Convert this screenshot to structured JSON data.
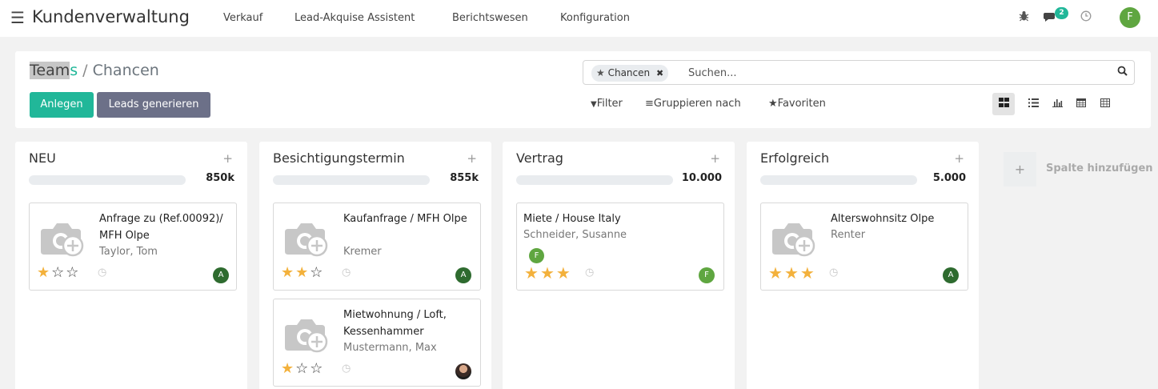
{
  "topbar": {
    "app_title": "Kundenverwaltung",
    "menu": [
      "Verkauf",
      "Lead-Akquise Assistent",
      "Berichtswesen",
      "Konfiguration"
    ],
    "message_count": "2",
    "user_initial": "F"
  },
  "breadcrumb": {
    "parent_main": "Team",
    "parent_end": "s",
    "separator": "/",
    "current": "Chancen"
  },
  "buttons": {
    "create": "Anlegen",
    "generate_leads": "Leads generieren"
  },
  "search": {
    "facet": "Chancen",
    "placeholder": "Suchen..."
  },
  "filters": {
    "filter": "Filter",
    "group_by": "Gruppieren nach",
    "favorites": "Favoriten"
  },
  "views": [
    "kanban",
    "list",
    "graph",
    "calendar",
    "pivot"
  ],
  "columns": [
    {
      "title": "NEU",
      "total": "850k",
      "cards": [
        {
          "title": "Anfrage zu (Ref.00092)/ MFH Olpe",
          "customer": "Taylor, Tom",
          "stars": 1,
          "avatar": "A"
        }
      ]
    },
    {
      "title": "Besichtigungstermin",
      "total": "855k",
      "cards": [
        {
          "title": "Kaufanfrage / MFH Olpe",
          "customer": "Kremer",
          "stars": 2,
          "avatar": "A"
        },
        {
          "title": "Mietwohnung / Loft, Kessenhammer",
          "customer": "Mustermann, Max",
          "stars": 1,
          "avatar": "photo"
        }
      ]
    },
    {
      "title": "Vertrag",
      "total": "10.000",
      "cards": [
        {
          "title": "Miete / House Italy",
          "customer": "Schneider, Susanne",
          "stars": 3,
          "avatar": "F",
          "tag_avatar": "F"
        }
      ]
    },
    {
      "title": "Erfolgreich",
      "total": "5.000",
      "cards": [
        {
          "title": "Alterswohnsitz Olpe",
          "customer": "Renter",
          "stars": 3,
          "avatar": "A"
        }
      ]
    }
  ],
  "add_column": {
    "plus": "+",
    "label": "Spalte hinzufügen"
  },
  "colors": {
    "accent": "#21b799",
    "secondary_button": "#6c7088",
    "star": "#f3b13c",
    "avatar_a": "#2e6b2f",
    "avatar_f": "#5fa640"
  }
}
